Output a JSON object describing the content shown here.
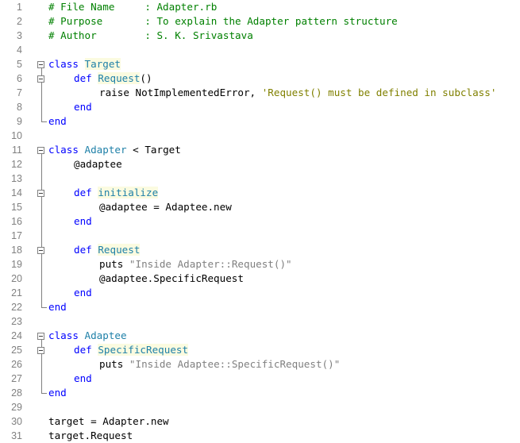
{
  "editor": {
    "line_numbers": [
      "1",
      "2",
      "3",
      "4",
      "5",
      "6",
      "7",
      "8",
      "9",
      "10",
      "11",
      "12",
      "13",
      "14",
      "15",
      "16",
      "17",
      "18",
      "19",
      "20",
      "21",
      "22",
      "23",
      "24",
      "25",
      "26",
      "27",
      "28",
      "29",
      "30",
      "31"
    ],
    "lines": {
      "l1": "# File Name     : Adapter.rb",
      "l2": "# Purpose       : To explain the Adapter pattern structure",
      "l3": "# Author        : S. K. Srivastava",
      "l5_kw": "class",
      "l5_name": "Target",
      "l6_kw": "def",
      "l6_name": "Request",
      "l6_tail": "()",
      "l7_plain": "raise NotImplementedError, ",
      "l7_str": "'Request() must be defined in subclass'",
      "l8_kw": "end",
      "l9_kw": "end",
      "l11_kw": "class",
      "l11_name": "Adapter",
      "l11_tail": " < Target",
      "l12": "@adaptee",
      "l14_kw": "def",
      "l14_name": "initialize",
      "l15": "@adaptee = Adaptee.new",
      "l16_kw": "end",
      "l18_kw": "def",
      "l18_name": "Request",
      "l19_plain": "puts ",
      "l19_str": "\"Inside Adapter::Request()\"",
      "l20": "@adaptee.SpecificRequest",
      "l21_kw": "end",
      "l22_kw": "end",
      "l24_kw": "class",
      "l24_name": "Adaptee",
      "l25_kw": "def",
      "l25_name": "SpecificRequest",
      "l26_plain": "puts ",
      "l26_str": "\"Inside Adaptee::SpecificRequest()\"",
      "l27_kw": "end",
      "l28_kw": "end",
      "l30": "target = Adapter.new",
      "l31": "target.Request"
    }
  },
  "colors": {
    "keyword": "#0000ff",
    "class_name": "#1f80a8",
    "comment": "#008000",
    "string": "#808080",
    "line_number": "#808080"
  }
}
